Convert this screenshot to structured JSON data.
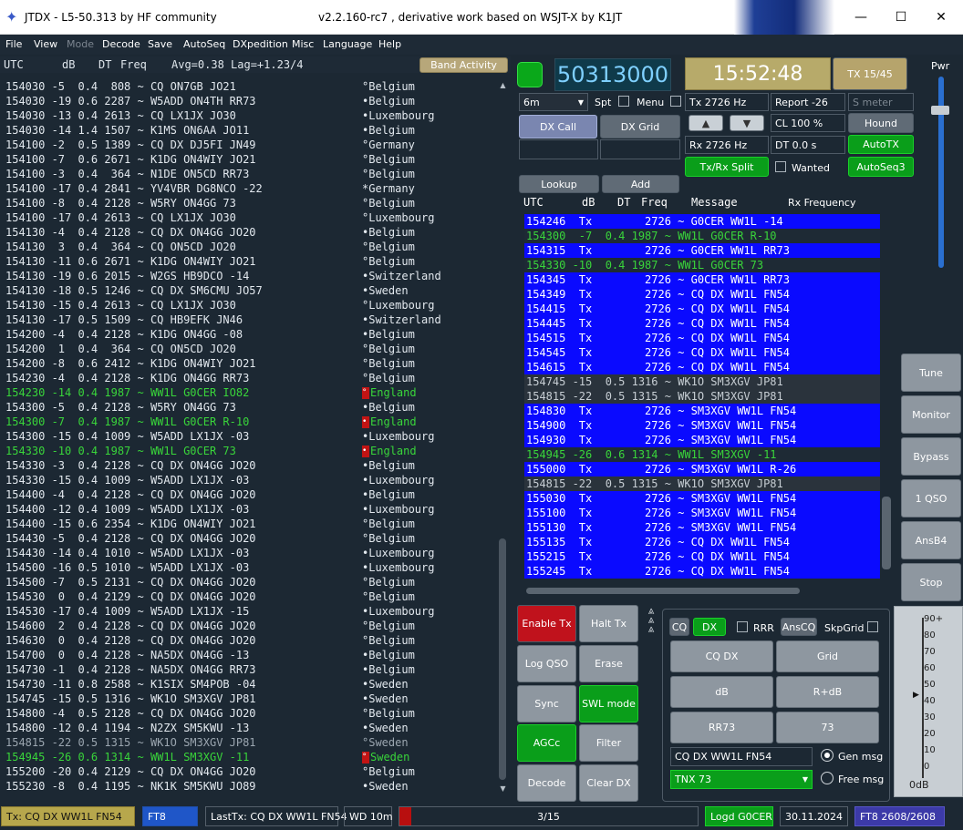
{
  "window": {
    "title_left": "JTDX - L5-50.313  by HF community",
    "title_right": "v2.2.160-rc7 , derivative work based on WSJT-X by K1JT",
    "minimize": "—",
    "maximize": "☐",
    "close": "✕"
  },
  "menu": [
    "File",
    "View",
    "Mode",
    "Decode",
    "Save",
    "AutoSeq",
    "DXpedition",
    "Misc",
    "Language",
    "Help"
  ],
  "left_header": {
    "utc": "UTC",
    "db": "dB",
    "dt": "DT",
    "freq": "Freq",
    "avg": "Avg=0.38 Lag=+1.23/4",
    "band_activity": "Band Activity"
  },
  "band_rows": [
    {
      "t": "154030 -5  0.4  808 ~ CQ ON7GB JO21",
      "c": "°Belgium",
      "k": "n"
    },
    {
      "t": "154030 -19 0.6 2287 ~ W5ADD ON4TH RR73",
      "c": "•Belgium",
      "k": "n"
    },
    {
      "t": "154030 -13 0.4 2613 ~ CQ LX1JX JO30",
      "c": "•Luxembourg",
      "k": "n"
    },
    {
      "t": "154030 -14 1.4 1507 ~ K1MS ON6AA JO11",
      "c": "•Belgium",
      "k": "n"
    },
    {
      "t": "154100 -2  0.5 1389 ~ CQ DX DJ5FI JN49",
      "c": "°Germany",
      "k": "n"
    },
    {
      "t": "154100 -7  0.6 2671 ~ K1DG ON4WIY JO21",
      "c": "°Belgium",
      "k": "n"
    },
    {
      "t": "154100 -3  0.4  364 ~ N1DE ON5CD RR73",
      "c": "°Belgium",
      "k": "n"
    },
    {
      "t": "154100 -17 0.4 2841 ~ YV4VBR DG8NCO -22",
      "c": "*Germany",
      "k": "n"
    },
    {
      "t": "154100 -8  0.4 2128 ~ W5RY ON4GG 73",
      "c": "°Belgium",
      "k": "n"
    },
    {
      "t": "154100 -17 0.4 2613 ~ CQ LX1JX JO30",
      "c": "°Luxembourg",
      "k": "n"
    },
    {
      "t": "154130 -4  0.4 2128 ~ CQ DX ON4GG JO20",
      "c": "•Belgium",
      "k": "n"
    },
    {
      "t": "154130  3  0.4  364 ~ CQ ON5CD JO20",
      "c": "°Belgium",
      "k": "n"
    },
    {
      "t": "154130 -11 0.6 2671 ~ K1DG ON4WIY JO21",
      "c": "°Belgium",
      "k": "n"
    },
    {
      "t": "154130 -19 0.6 2015 ~ W2GS HB9DCO -14",
      "c": "•Switzerland",
      "k": "n"
    },
    {
      "t": "154130 -18 0.5 1246 ~ CQ DX SM6CMU JO57",
      "c": "•Sweden",
      "k": "n"
    },
    {
      "t": "154130 -15 0.4 2613 ~ CQ LX1JX JO30",
      "c": "°Luxembourg",
      "k": "n"
    },
    {
      "t": "154130 -17 0.5 1509 ~ CQ HB9EFK JN46",
      "c": "•Switzerland",
      "k": "n"
    },
    {
      "t": "154200 -4  0.4 2128 ~ K1DG ON4GG -08",
      "c": "•Belgium",
      "k": "n"
    },
    {
      "t": "154200  1  0.4  364 ~ CQ ON5CD JO20",
      "c": "°Belgium",
      "k": "n"
    },
    {
      "t": "154200 -8  0.6 2412 ~ K1DG ON4WIY JO21",
      "c": "°Belgium",
      "k": "n"
    },
    {
      "t": "154230 -4  0.4 2128 ~ K1DG ON4GG RR73",
      "c": "°Belgium",
      "k": "n"
    },
    {
      "t": "154230 -14 0.4 1987 ~ WW1L G0CER IO82",
      "c": "England",
      "k": "g",
      "f": "°"
    },
    {
      "t": "154300 -5  0.4 2128 ~ W5RY ON4GG 73",
      "c": "•Belgium",
      "k": "n"
    },
    {
      "t": "154300 -7  0.4 1987 ~ WW1L G0CER R-10",
      "c": "England",
      "k": "g",
      "f": "•"
    },
    {
      "t": "154300 -15 0.4 1009 ~ W5ADD LX1JX -03",
      "c": "•Luxembourg",
      "k": "n"
    },
    {
      "t": "154330 -10 0.4 1987 ~ WW1L G0CER 73",
      "c": "England",
      "k": "g",
      "f": "•"
    },
    {
      "t": "154330 -3  0.4 2128 ~ CQ DX ON4GG JO20",
      "c": "•Belgium",
      "k": "n"
    },
    {
      "t": "154330 -15 0.4 1009 ~ W5ADD LX1JX -03",
      "c": "•Luxembourg",
      "k": "n"
    },
    {
      "t": "154400 -4  0.4 2128 ~ CQ DX ON4GG JO20",
      "c": "•Belgium",
      "k": "n"
    },
    {
      "t": "154400 -12 0.4 1009 ~ W5ADD LX1JX -03",
      "c": "•Luxembourg",
      "k": "n"
    },
    {
      "t": "154400 -15 0.6 2354 ~ K1DG ON4WIY JO21",
      "c": "°Belgium",
      "k": "n"
    },
    {
      "t": "154430 -5  0.4 2128 ~ CQ DX ON4GG JO20",
      "c": "°Belgium",
      "k": "n"
    },
    {
      "t": "154430 -14 0.4 1010 ~ W5ADD LX1JX -03",
      "c": "•Luxembourg",
      "k": "n"
    },
    {
      "t": "154500 -16 0.5 1010 ~ W5ADD LX1JX -03",
      "c": "•Luxembourg",
      "k": "n"
    },
    {
      "t": "154500 -7  0.5 2131 ~ CQ DX ON4GG JO20",
      "c": "°Belgium",
      "k": "n"
    },
    {
      "t": "154530  0  0.4 2129 ~ CQ DX ON4GG JO20",
      "c": "°Belgium",
      "k": "n"
    },
    {
      "t": "154530 -17 0.4 1009 ~ W5ADD LX1JX -15",
      "c": "•Luxembourg",
      "k": "n"
    },
    {
      "t": "154600  2  0.4 2128 ~ CQ DX ON4GG JO20",
      "c": "°Belgium",
      "k": "n"
    },
    {
      "t": "154630  0  0.4 2128 ~ CQ DX ON4GG JO20",
      "c": "°Belgium",
      "k": "n"
    },
    {
      "t": "154700  0  0.4 2128 ~ NA5DX ON4GG -13",
      "c": "•Belgium",
      "k": "n"
    },
    {
      "t": "154730 -1  0.4 2128 ~ NA5DX ON4GG RR73",
      "c": "•Belgium",
      "k": "n"
    },
    {
      "t": "154730 -11 0.8 2588 ~ K1SIX SM4POB -04",
      "c": "•Sweden",
      "k": "n"
    },
    {
      "t": "154745 -15 0.5 1316 ~ WK1O SM3XGV JP81",
      "c": "•Sweden",
      "k": "n"
    },
    {
      "t": "154800 -4  0.5 2128 ~ CQ DX ON4GG JO20",
      "c": "°Belgium",
      "k": "n"
    },
    {
      "t": "154800 -12 0.4 1194 ~ N2ZX SM5KWU -13",
      "c": "•Sweden",
      "k": "n"
    },
    {
      "t": "154815 -22 0.5 1315 ~ WK1O SM3XGV JP81",
      "c": "°Sweden",
      "k": "y"
    },
    {
      "t": "154945 -26 0.6 1314 ~ WW1L SM3XGV -11",
      "c": "Sweden",
      "k": "g",
      "f": "°"
    },
    {
      "t": "155200 -20 0.4 2129 ~ CQ DX ON4GG JO20",
      "c": "°Belgium",
      "k": "n"
    },
    {
      "t": "155230 -8  0.4 1195 ~ NK1K SM5KWU JO89",
      "c": "•Sweden",
      "k": "n"
    }
  ],
  "controls": {
    "freq_display": "50313000",
    "clock": "15:52:48",
    "tx_period": "TX 15/45",
    "pwr": "Pwr",
    "band": "6m",
    "spt": "Spt",
    "menu": "Menu",
    "tx_hz": "Tx  2726  Hz",
    "report": "Report -26",
    "s_meter": "S meter",
    "dx_call": "DX Call",
    "dx_grid": "DX Grid",
    "cl": "CL  100 %",
    "hound": "Hound",
    "rx_hz": "Rx  2726  Hz",
    "dt": "DT  0.0 s",
    "autotx": "AutoTX",
    "txrx_split": "Tx/Rx Split",
    "wanted": "Wanted",
    "autoseq": "AutoSeq3",
    "lookup": "Lookup",
    "add": "Add",
    "up": "▲",
    "down": "▼"
  },
  "rx_header": {
    "utc": "UTC",
    "db": "dB",
    "dt": "DT",
    "freq": "Freq",
    "message": "Message",
    "rxfreq": "Rx Frequency"
  },
  "rx_rows": [
    {
      "t": "154246  Tx        2726 ~ G0CER WW1L -14",
      "k": "tx"
    },
    {
      "t": "154300  -7  0.4 1987 ~ WW1L G0CER R-10",
      "k": "rx"
    },
    {
      "t": "154315  Tx        2726 ~ G0CER WW1L RR73",
      "k": "tx"
    },
    {
      "t": "154330 -10  0.4 1987 ~ WW1L G0CER 73",
      "k": "rx"
    },
    {
      "t": "154345  Tx        2726 ~ G0CER WW1L RR73",
      "k": "tx"
    },
    {
      "t": "154349  Tx        2726 ~ CQ DX WW1L FN54",
      "k": "tx"
    },
    {
      "t": "154415  Tx        2726 ~ CQ DX WW1L FN54",
      "k": "tx"
    },
    {
      "t": "154445  Tx        2726 ~ CQ DX WW1L FN54",
      "k": "tx"
    },
    {
      "t": "154515  Tx        2726 ~ CQ DX WW1L FN54",
      "k": "tx"
    },
    {
      "t": "154545  Tx        2726 ~ CQ DX WW1L FN54",
      "k": "tx"
    },
    {
      "t": "154615  Tx        2726 ~ CQ DX WW1L FN54",
      "k": "tx"
    },
    {
      "t": "154745 -15  0.5 1316 ~ WK1O SM3XGV JP81",
      "k": "ot"
    },
    {
      "t": "154815 -22  0.5 1315 ~ WK1O SM3XGV JP81",
      "k": "ot"
    },
    {
      "t": "154830  Tx        2726 ~ SM3XGV WW1L FN54",
      "k": "tx"
    },
    {
      "t": "154900  Tx        2726 ~ SM3XGV WW1L FN54",
      "k": "tx"
    },
    {
      "t": "154930  Tx        2726 ~ SM3XGV WW1L FN54",
      "k": "tx"
    },
    {
      "t": "154945 -26  0.6 1314 ~ WW1L SM3XGV -11",
      "k": "rx"
    },
    {
      "t": "155000  Tx        2726 ~ SM3XGV WW1L R-26",
      "k": "tx"
    },
    {
      "t": "154815 -22  0.5 1315 ~ WK1O SM3XGV JP81",
      "k": "ot"
    },
    {
      "t": "155030  Tx        2726 ~ SM3XGV WW1L FN54",
      "k": "tx"
    },
    {
      "t": "155100  Tx        2726 ~ SM3XGV WW1L FN54",
      "k": "tx"
    },
    {
      "t": "155130  Tx        2726 ~ SM3XGV WW1L FN54",
      "k": "tx"
    },
    {
      "t": "155135  Tx        2726 ~ CQ DX WW1L FN54",
      "k": "tx"
    },
    {
      "t": "155215  Tx        2726 ~ CQ DX WW1L FN54",
      "k": "tx"
    },
    {
      "t": "155245  Tx        2726 ~ CQ DX WW1L FN54",
      "k": "tx"
    }
  ],
  "side_buttons": [
    "Tune",
    "Monitor",
    "Bypass",
    "1 QSO",
    "AnsB4",
    "Stop"
  ],
  "bottom_buttons": {
    "enable_tx": "Enable Tx",
    "halt_tx": "Halt Tx",
    "log_qso": "Log QSO",
    "erase": "Erase",
    "sync": "Sync",
    "swl": "SWL mode",
    "agcc": "AGCc",
    "filter": "Filter",
    "decode": "Decode",
    "clear_dx": "Clear DX"
  },
  "tx_panel": {
    "cq": "CQ",
    "dx": "DX",
    "rrr": "RRR",
    "anscq": "AnsCQ",
    "skpgrid": "SkpGrid",
    "cqdx": "CQ DX",
    "grid": "Grid",
    "db": "dB",
    "rdb": "R+dB",
    "rr73": "RR73",
    "s73": "73",
    "msg": "CQ DX WW1L FN54",
    "gen": "Gen msg",
    "free": "Free msg",
    "tnx": "TNX 73"
  },
  "meter": {
    "ticks": [
      "90+",
      "80",
      "70",
      "60",
      "50",
      "40",
      "30",
      "20",
      "10",
      "0"
    ],
    "bottom": "0dB"
  },
  "status": {
    "tx": "Tx: CQ DX WW1L FN54",
    "mode": "FT8",
    "last": "LastTx: CQ DX WW1L FN54",
    "wd": "WD 10m",
    "progress": "3/15",
    "progress_fraction": 0.2,
    "logd": "Logd G0CER",
    "date": "30.11.2024",
    "ft8count": "FT8  2608/2608"
  }
}
